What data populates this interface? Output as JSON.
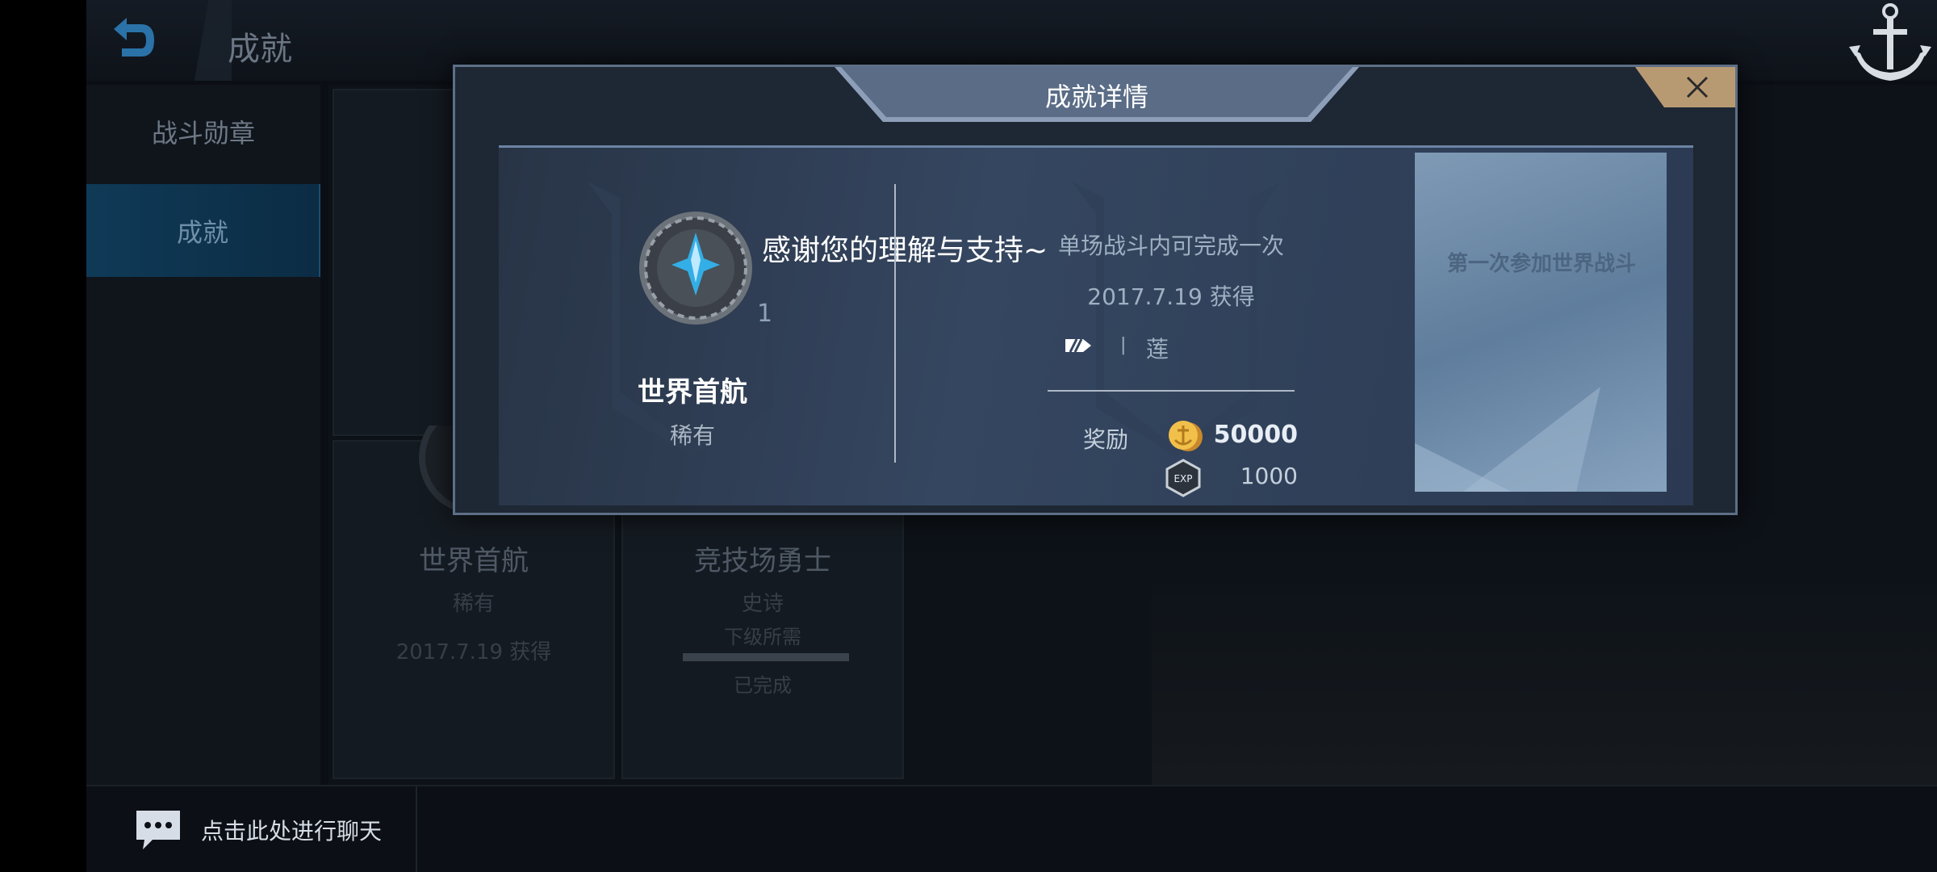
{
  "header": {
    "back_icon": "back-arrow-icon",
    "title": "成就",
    "logo_icon": "anchor-icon"
  },
  "sidebar": {
    "items": [
      {
        "label": "战斗勋章",
        "active": false
      },
      {
        "label": "成就",
        "active": true
      }
    ]
  },
  "cards": [
    {
      "name": "世界首航",
      "rarity": "稀有",
      "date": "2017.7.19 获得"
    },
    {
      "name": "竞技场勇士",
      "rarity": "史诗",
      "sub": "下级所需",
      "status": "已完成"
    }
  ],
  "chat": {
    "icon": "chat-bubble-icon",
    "label": "点击此处进行聊天"
  },
  "modal": {
    "title": "成就详情",
    "close_icon": "close-icon",
    "badge": {
      "count": "1",
      "name": "世界首航",
      "rarity": "稀有"
    },
    "thanks": "感谢您的理解与支持~",
    "condition": "单场战斗内可完成一次",
    "obtained": "2017.7.19 获得",
    "player": {
      "separator": "|",
      "name": "莲"
    },
    "reward": {
      "label": "奖励",
      "gold": "50000",
      "exp": "1000"
    },
    "description": "第一次参加世界战斗"
  }
}
